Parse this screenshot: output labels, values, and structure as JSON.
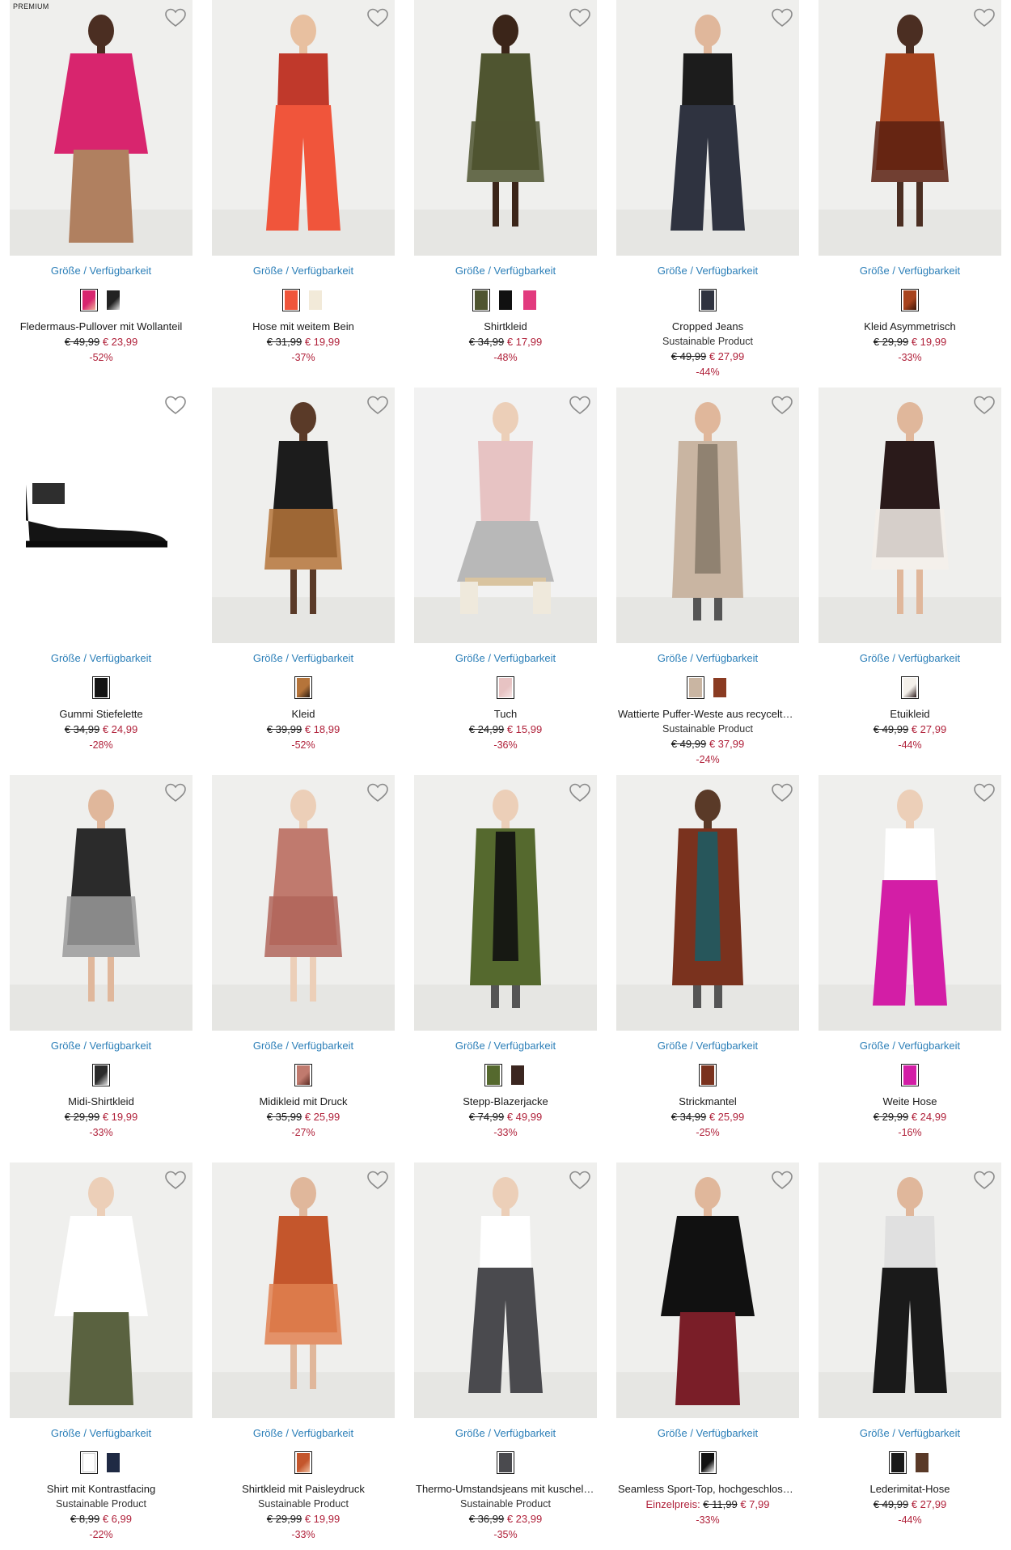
{
  "ui": {
    "size_link": "Größe / Verfügbarkeit",
    "premium_label": "PREMIUM",
    "heart_icon": "heart-outline-icon"
  },
  "products": [
    {
      "name": "Fledermaus-Pullover mit Wollanteil",
      "sub": "",
      "old": "€ 49,99",
      "new": "€ 23,99",
      "disc": "-52%",
      "premium": true,
      "img": {
        "bg": "#efefed",
        "top": "#d8256e",
        "bottom": "#b08060",
        "skin": "#4b2e22",
        "shape": "person"
      },
      "swatches": [
        {
          "c1": "#d8256e",
          "c2": "#f0b59a"
        },
        {
          "c1": "#222222",
          "c2": "#e6e6e6"
        }
      ]
    },
    {
      "name": "Hose mit weitem Bein",
      "sub": "",
      "old": "€ 31,99",
      "new": "€ 19,99",
      "disc": "-37%",
      "img": {
        "bg": "#efefed",
        "top": "#c0392b",
        "bottom": "#f0553b",
        "skin": "#e8c0a0",
        "shape": "pants"
      },
      "swatches": [
        {
          "c1": "#f0553b",
          "c2": "#f0553b"
        },
        {
          "c1": "#f2ead9",
          "c2": "#f2ead9"
        }
      ]
    },
    {
      "name": "Shirtkleid",
      "sub": "",
      "old": "€ 34,99",
      "new": "€ 17,99",
      "disc": "-48%",
      "img": {
        "bg": "#efefed",
        "top": "#4f5530",
        "bottom": "#4f5530",
        "skin": "#3b2519",
        "shape": "dress"
      },
      "swatches": [
        {
          "c1": "#4f5530",
          "c2": "#4f5530"
        },
        {
          "c1": "#111111",
          "c2": "#111111"
        },
        {
          "c1": "#e23a7e",
          "c2": "#e23a7e"
        }
      ]
    },
    {
      "name": "Cropped Jeans",
      "sub": "Sustainable Product",
      "old": "€ 49,99",
      "new": "€ 27,99",
      "disc": "-44%",
      "img": {
        "bg": "#efefed",
        "top": "#1c1c1c",
        "bottom": "#2f3340",
        "skin": "#e0b79b",
        "shape": "pants"
      },
      "swatches": [
        {
          "c1": "#2f3340",
          "c2": "#2f3340"
        }
      ]
    },
    {
      "name": "Kleid Asymmetrisch",
      "sub": "",
      "old": "€ 29,99",
      "new": "€ 19,99",
      "disc": "-33%",
      "img": {
        "bg": "#efefed",
        "top": "#a8441e",
        "bottom": "#5a2010",
        "skin": "#4b2e22",
        "shape": "dress"
      },
      "swatches": [
        {
          "c1": "#a8441e",
          "c2": "#3b1508"
        }
      ]
    },
    {
      "name": "Gummi Stiefelette",
      "sub": "",
      "old": "€ 34,99",
      "new": "€ 24,99",
      "disc": "-28%",
      "img": {
        "bg": "#ffffff",
        "top": "#141414",
        "bottom": "#141414",
        "skin": "#141414",
        "shape": "boot"
      },
      "swatches": [
        {
          "c1": "#141414",
          "c2": "#141414"
        }
      ]
    },
    {
      "name": "Kleid",
      "sub": "",
      "old": "€ 39,99",
      "new": "€ 18,99",
      "disc": "-52%",
      "img": {
        "bg": "#efefed",
        "top": "#1c1c1c",
        "bottom": "#b5743a",
        "skin": "#5a3a28",
        "shape": "dress"
      },
      "swatches": [
        {
          "c1": "#b5743a",
          "c2": "#2a1a10"
        }
      ]
    },
    {
      "name": "Tuch",
      "sub": "",
      "old": "€ 24,99",
      "new": "€ 15,99",
      "disc": "-36%",
      "img": {
        "bg": "#f2f2f2",
        "top": "#e7c3c3",
        "bottom": "#b8b8b8",
        "skin": "#eccfb8",
        "shape": "sit"
      },
      "swatches": [
        {
          "c1": "#e7c3c3",
          "c2": "#f7e6e6"
        }
      ]
    },
    {
      "name": "Wattierte Puffer-Weste aus recyceltem Polyester",
      "sub": "Sustainable Product",
      "old": "€ 49,99",
      "new": "€ 37,99",
      "disc": "-24%",
      "img": {
        "bg": "#efefed",
        "top": "#c9b5a2",
        "bottom": "#8a7c6c",
        "skin": "#e0b79b",
        "shape": "coat"
      },
      "swatches": [
        {
          "c1": "#c9b5a2",
          "c2": "#c9b5a2"
        },
        {
          "c1": "#8a3b22",
          "c2": "#8a3b22"
        }
      ]
    },
    {
      "name": "Etuikleid",
      "sub": "",
      "old": "€ 49,99",
      "new": "€ 27,99",
      "disc": "-44%",
      "img": {
        "bg": "#efefed",
        "top": "#2a1a1a",
        "bottom": "#f4f0ea",
        "skin": "#e0b79b",
        "shape": "dress"
      },
      "swatches": [
        {
          "c1": "#f4f0ea",
          "c2": "#2a1a1a"
        }
      ]
    },
    {
      "name": "Midi-Shirtkleid",
      "sub": "",
      "old": "€ 29,99",
      "new": "€ 19,99",
      "disc": "-33%",
      "img": {
        "bg": "#efefed",
        "top": "#2b2b2b",
        "bottom": "#9a9a9a",
        "skin": "#e0b79b",
        "shape": "dress"
      },
      "swatches": [
        {
          "c1": "#2b2b2b",
          "c2": "#dddddd"
        }
      ]
    },
    {
      "name": "Midikleid mit Druck",
      "sub": "",
      "old": "€ 35,99",
      "new": "€ 25,99",
      "disc": "-27%",
      "img": {
        "bg": "#efefed",
        "top": "#c07a6e",
        "bottom": "#b0655a",
        "skin": "#eccfb8",
        "shape": "dress"
      },
      "swatches": [
        {
          "c1": "#c07a6e",
          "c2": "#5a2a22"
        }
      ]
    },
    {
      "name": "Stepp-Blazerjacke",
      "sub": "",
      "old": "€ 74,99",
      "new": "€ 49,99",
      "disc": "-33%",
      "img": {
        "bg": "#efefed",
        "top": "#55692e",
        "bottom": "#111111",
        "skin": "#eccfb8",
        "shape": "coat"
      },
      "swatches": [
        {
          "c1": "#55692e",
          "c2": "#55692e"
        },
        {
          "c1": "#3b2620",
          "c2": "#3b2620"
        }
      ]
    },
    {
      "name": "Strickmantel",
      "sub": "",
      "old": "€ 34,99",
      "new": "€ 25,99",
      "disc": "-25%",
      "img": {
        "bg": "#efefed",
        "top": "#7a321e",
        "bottom": "#1e5a62",
        "skin": "#5a3a28",
        "shape": "coat"
      },
      "swatches": [
        {
          "c1": "#7a321e",
          "c2": "#7a321e"
        }
      ]
    },
    {
      "name": "Weite Hose",
      "sub": "",
      "old": "€ 29,99",
      "new": "€ 24,99",
      "disc": "-16%",
      "img": {
        "bg": "#efefed",
        "top": "#ffffff",
        "bottom": "#d31ea6",
        "skin": "#eccfb8",
        "shape": "pants"
      },
      "swatches": [
        {
          "c1": "#d31ea6",
          "c2": "#d31ea6"
        }
      ]
    },
    {
      "name": "Shirt mit Kontrastfacing",
      "sub": "Sustainable Product",
      "old": "€ 8,99",
      "new": "€ 6,99",
      "disc": "-22%",
      "img": {
        "bg": "#efefed",
        "top": "#ffffff",
        "bottom": "#5a6240",
        "skin": "#eccfb8",
        "shape": "person"
      },
      "swatches": [
        {
          "c1": "#ffffff",
          "c2": "#ffffff"
        },
        {
          "c1": "#1f2a44",
          "c2": "#1f2a44"
        }
      ]
    },
    {
      "name": "Shirtkleid mit Paisleydruck",
      "sub": "Sustainable Product",
      "old": "€ 29,99",
      "new": "€ 19,99",
      "disc": "-33%",
      "img": {
        "bg": "#efefed",
        "top": "#c4562c",
        "bottom": "#e08050",
        "skin": "#e0b79b",
        "shape": "dress"
      },
      "swatches": [
        {
          "c1": "#c4562c",
          "c2": "#f0c0a0"
        }
      ]
    },
    {
      "name": "Thermo-Umstandsjeans mit kuscheligem Innenfutter",
      "sub": "Sustainable Product",
      "old": "€ 36,99",
      "new": "€ 23,99",
      "disc": "-35%",
      "img": {
        "bg": "#efefed",
        "top": "#ffffff",
        "bottom": "#4a4a4e",
        "skin": "#eccfb8",
        "shape": "pants"
      },
      "swatches": [
        {
          "c1": "#4a4a4e",
          "c2": "#4a4a4e"
        }
      ]
    },
    {
      "name": "Seamless Sport-Top, hochgeschlossen",
      "sub": "",
      "single_label": "Einzelpreis:",
      "old": "€ 11,99",
      "new": "€ 7,99",
      "disc": "-33%",
      "img": {
        "bg": "#efefed",
        "top": "#111111",
        "bottom": "#7a1e28",
        "skin": "#e0b79b",
        "shape": "person"
      },
      "swatches": [
        {
          "c1": "#111111",
          "c2": "#ffffff"
        }
      ]
    },
    {
      "name": "Lederimitat-Hose",
      "sub": "",
      "old": "€ 49,99",
      "new": "€ 27,99",
      "disc": "-44%",
      "img": {
        "bg": "#efefed",
        "top": "#e0e0e0",
        "bottom": "#1a1a1a",
        "skin": "#e0b79b",
        "shape": "pants"
      },
      "swatches": [
        {
          "c1": "#1a1a1a",
          "c2": "#1a1a1a"
        },
        {
          "c1": "#5a3a28",
          "c2": "#5a3a28"
        }
      ]
    }
  ]
}
